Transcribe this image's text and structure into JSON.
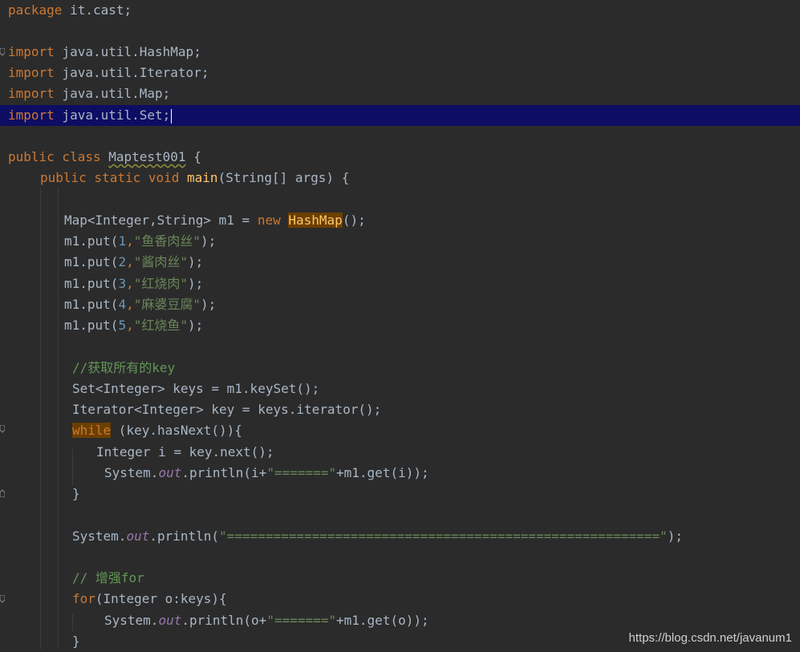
{
  "editor": {
    "lines": {
      "l1": {
        "kw": "package",
        "rest": " it.cast;"
      },
      "l3": {
        "kw": "import",
        "rest": " java.util.HashMap;"
      },
      "l4": {
        "kw": "import",
        "rest": " java.util.Iterator;"
      },
      "l5": {
        "kw": "import",
        "rest": " java.util.Map;"
      },
      "l6": {
        "kw": "import",
        "rest": " java.util.Set;"
      },
      "l8": {
        "kw": "public class",
        "cls": "Maptest001",
        "rest": " {"
      },
      "l9": {
        "kw": "public static void",
        "fn": "main",
        "rest": "(String[] args) {"
      },
      "l11": {
        "a": "Map<Integer,String> m1 = ",
        "kw": "new",
        "hl": "HashMap",
        "rest": "();"
      },
      "l12": {
        "a": "m1.put(",
        "num": "1",
        "b": ",",
        "str": "\"鱼香肉丝\"",
        "rest": ");"
      },
      "l13": {
        "a": "m1.put(",
        "num": "2",
        "b": ",",
        "str": "\"酱肉丝\"",
        "rest": ");"
      },
      "l14": {
        "a": "m1.put(",
        "num": "3",
        "b": ",",
        "str": "\"红烧肉\"",
        "rest": ");"
      },
      "l15": {
        "a": "m1.put(",
        "num": "4",
        "b": ",",
        "str": "\"麻婆豆腐\"",
        "rest": ");"
      },
      "l16": {
        "a": "m1.put(",
        "num": "5",
        "b": ",",
        "str": "\"红烧鱼\"",
        "rest": ");"
      },
      "l18": {
        "cmt": "//获取所有的key"
      },
      "l19": {
        "a": "Set<Integer> keys = m1.keySet();"
      },
      "l20": {
        "a": "Iterator<Integer> key = keys.iterator();"
      },
      "l21": {
        "hl": "while",
        "rest": " (key.hasNext()){"
      },
      "l22": {
        "a": "Integer i = key.next();"
      },
      "l23": {
        "a": "System.",
        "field": "out",
        "b": ".println(i+",
        "str": "\"=======\"",
        "rest": "+m1.get(i));"
      },
      "l24": {
        "a": "}"
      },
      "l26": {
        "a": "System.",
        "field": "out",
        "b": ".println(",
        "str": "\"========================================================\"",
        "rest": ");"
      },
      "l28": {
        "cmt": "// 增强for"
      },
      "l29": {
        "kw": "for",
        "rest": "(Integer o:keys){"
      },
      "l30": {
        "a": "System.",
        "field": "out",
        "b": ".println(o+",
        "str": "\"=======\"",
        "rest": "+m1.get(o));"
      },
      "l31": {
        "a": "}"
      }
    }
  },
  "watermark": "https://blog.csdn.net/javanum1",
  "colors": {
    "background": "#2b2b2b",
    "keyword": "#cc7832",
    "string": "#6a8759",
    "number": "#6897bb",
    "comment": "#629755",
    "field": "#9876aa",
    "current_line": "#0d0d63",
    "highlight": "#6b3f00"
  }
}
